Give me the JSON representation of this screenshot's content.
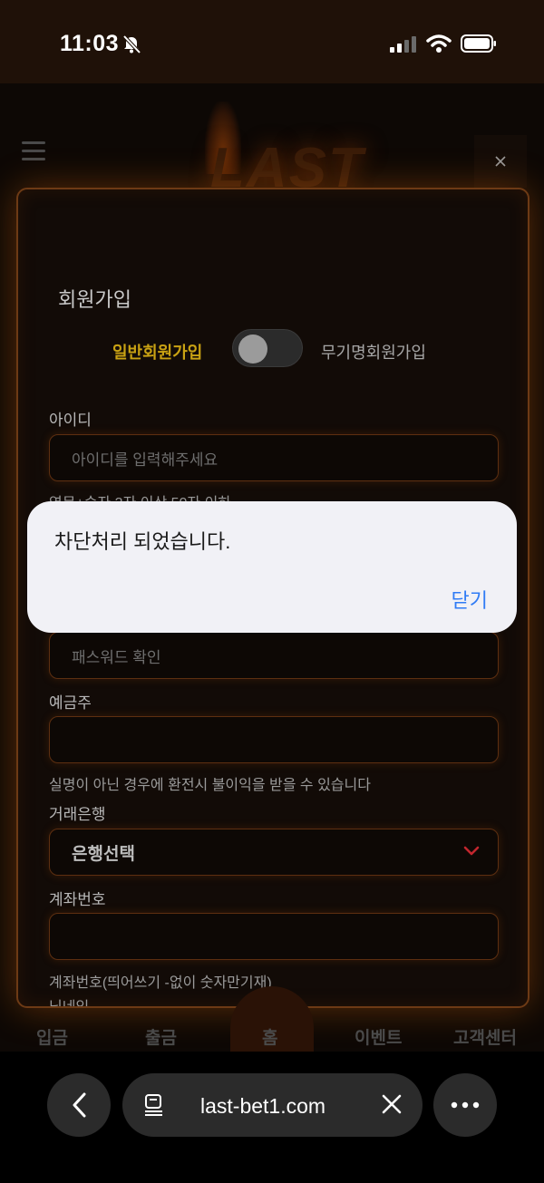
{
  "status_bar": {
    "time": "11:03"
  },
  "signup": {
    "title": "회원가입",
    "toggle": {
      "left_option": "일반회원가입",
      "right_option": "무기명회원가입"
    },
    "fields": {
      "id": {
        "label": "아이디",
        "placeholder": "아이디를 입력해주세요",
        "hint": "영문+숫자 3자 이상 50자 이하"
      },
      "password_confirm": {
        "placeholder": "패스워드 확인"
      },
      "depositor": {
        "label": "예금주",
        "hint": "실명이 아닌 경우에 환전시 불이익을 받을 수 있습니다"
      },
      "bank": {
        "label": "거래은행",
        "selected": "은행선택"
      },
      "account": {
        "label": "계좌번호",
        "hint": "계좌번호(띄어쓰기 -없이 숫자만기재)"
      },
      "nickname": {
        "label": "닉네임"
      }
    }
  },
  "alert": {
    "message": "차단처리 되었습니다.",
    "close_label": "닫기"
  },
  "bottom_nav": {
    "items": [
      "입금",
      "출금",
      "홈",
      "이벤트",
      "고객센터"
    ]
  },
  "browser": {
    "url": "last-bet1.com"
  },
  "colors": {
    "accent_gold": "#c9a213",
    "link_blue": "#2f7bf5",
    "glow_orange": "#6d3a15"
  }
}
